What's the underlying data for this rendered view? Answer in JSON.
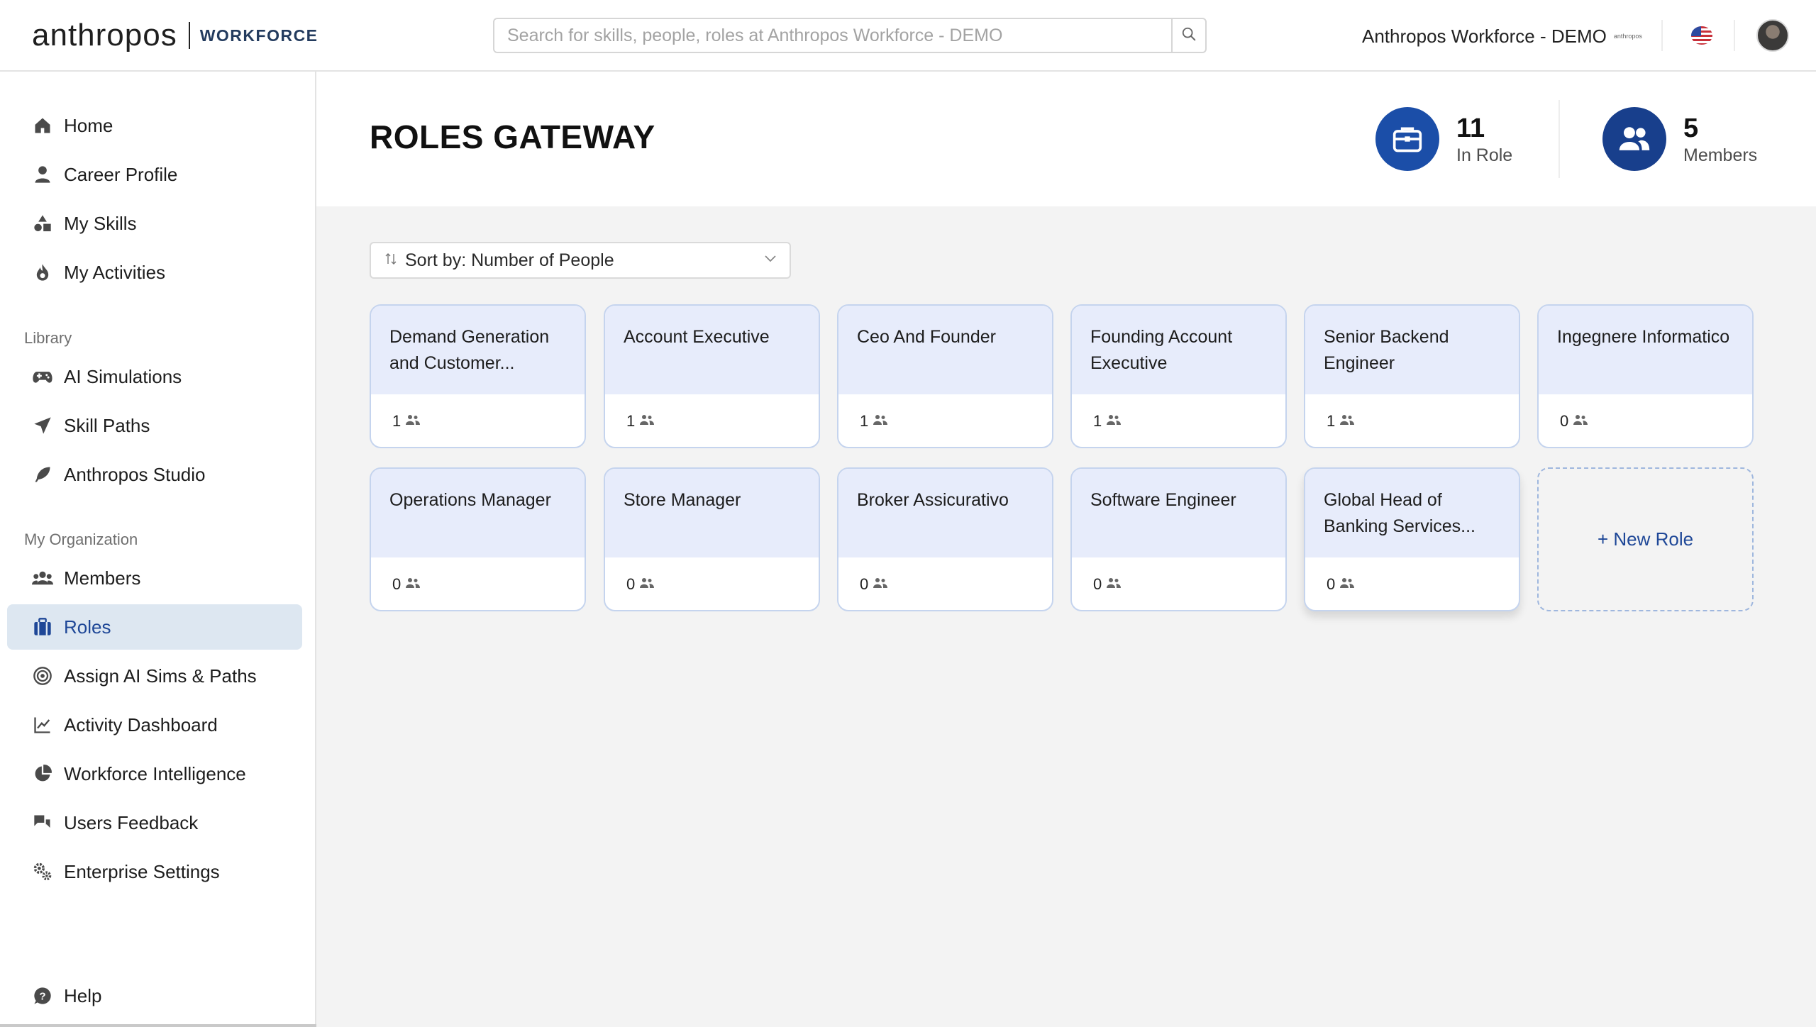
{
  "topbar": {
    "logo": "anthropos",
    "logo_sub": "WORKFORCE",
    "search_placeholder": "Search for skills, people, roles at Anthropos Workforce - DEMO",
    "org_name": "Anthropos Workforce - DEMO",
    "org_mini": "anthropos",
    "search_icon": "search-icon",
    "flag_icon": "us-flag-icon"
  },
  "sidebar": {
    "main_items": [
      {
        "label": "Home",
        "icon": "home-icon"
      },
      {
        "label": "Career Profile",
        "icon": "person-icon"
      },
      {
        "label": "My Skills",
        "icon": "shapes-icon"
      },
      {
        "label": "My Activities",
        "icon": "flame-icon"
      }
    ],
    "library_label": "Library",
    "library_items": [
      {
        "label": "AI Simulations",
        "icon": "gamepad-icon"
      },
      {
        "label": "Skill Paths",
        "icon": "paper-plane-icon"
      },
      {
        "label": "Anthropos Studio",
        "icon": "feather-icon"
      }
    ],
    "org_label": "My Organization",
    "org_items": [
      {
        "label": "Members",
        "icon": "users-icon"
      },
      {
        "label": "Roles",
        "icon": "briefcase-icon"
      },
      {
        "label": "Assign AI Sims & Paths",
        "icon": "target-icon"
      },
      {
        "label": "Activity Dashboard",
        "icon": "line-chart-icon"
      },
      {
        "label": "Workforce Intelligence",
        "icon": "pie-chart-icon"
      },
      {
        "label": "Users Feedback",
        "icon": "chat-bubbles-icon"
      },
      {
        "label": "Enterprise Settings",
        "icon": "gears-icon"
      }
    ],
    "help_label": "Help",
    "active": "Roles"
  },
  "header": {
    "title": "ROLES GATEWAY",
    "in_role_count": "11",
    "in_role_label": "In Role",
    "members_count": "5",
    "members_label": "Members"
  },
  "sort": {
    "label": "Sort by: Number of People"
  },
  "roles": [
    {
      "title": "Demand Generation and Customer...",
      "count": "1"
    },
    {
      "title": "Account Executive",
      "count": "1"
    },
    {
      "title": "Ceo And Founder",
      "count": "1"
    },
    {
      "title": "Founding Account Executive",
      "count": "1"
    },
    {
      "title": "Senior Backend Engineer",
      "count": "1"
    },
    {
      "title": "Ingegnere Informatico",
      "count": "0"
    },
    {
      "title": "Operations Manager",
      "count": "0"
    },
    {
      "title": "Store Manager",
      "count": "0"
    },
    {
      "title": "Broker Assicurativo",
      "count": "0"
    },
    {
      "title": "Software Engineer",
      "count": "0"
    },
    {
      "title": "Global Head of Banking Services...",
      "count": "0"
    }
  ],
  "new_role_label": "+ New Role",
  "colors": {
    "accent": "#1e4797",
    "active_bg": "#dde7f1",
    "card_top": "#e7ecfb",
    "stat_circle": "#1b4ea8"
  }
}
